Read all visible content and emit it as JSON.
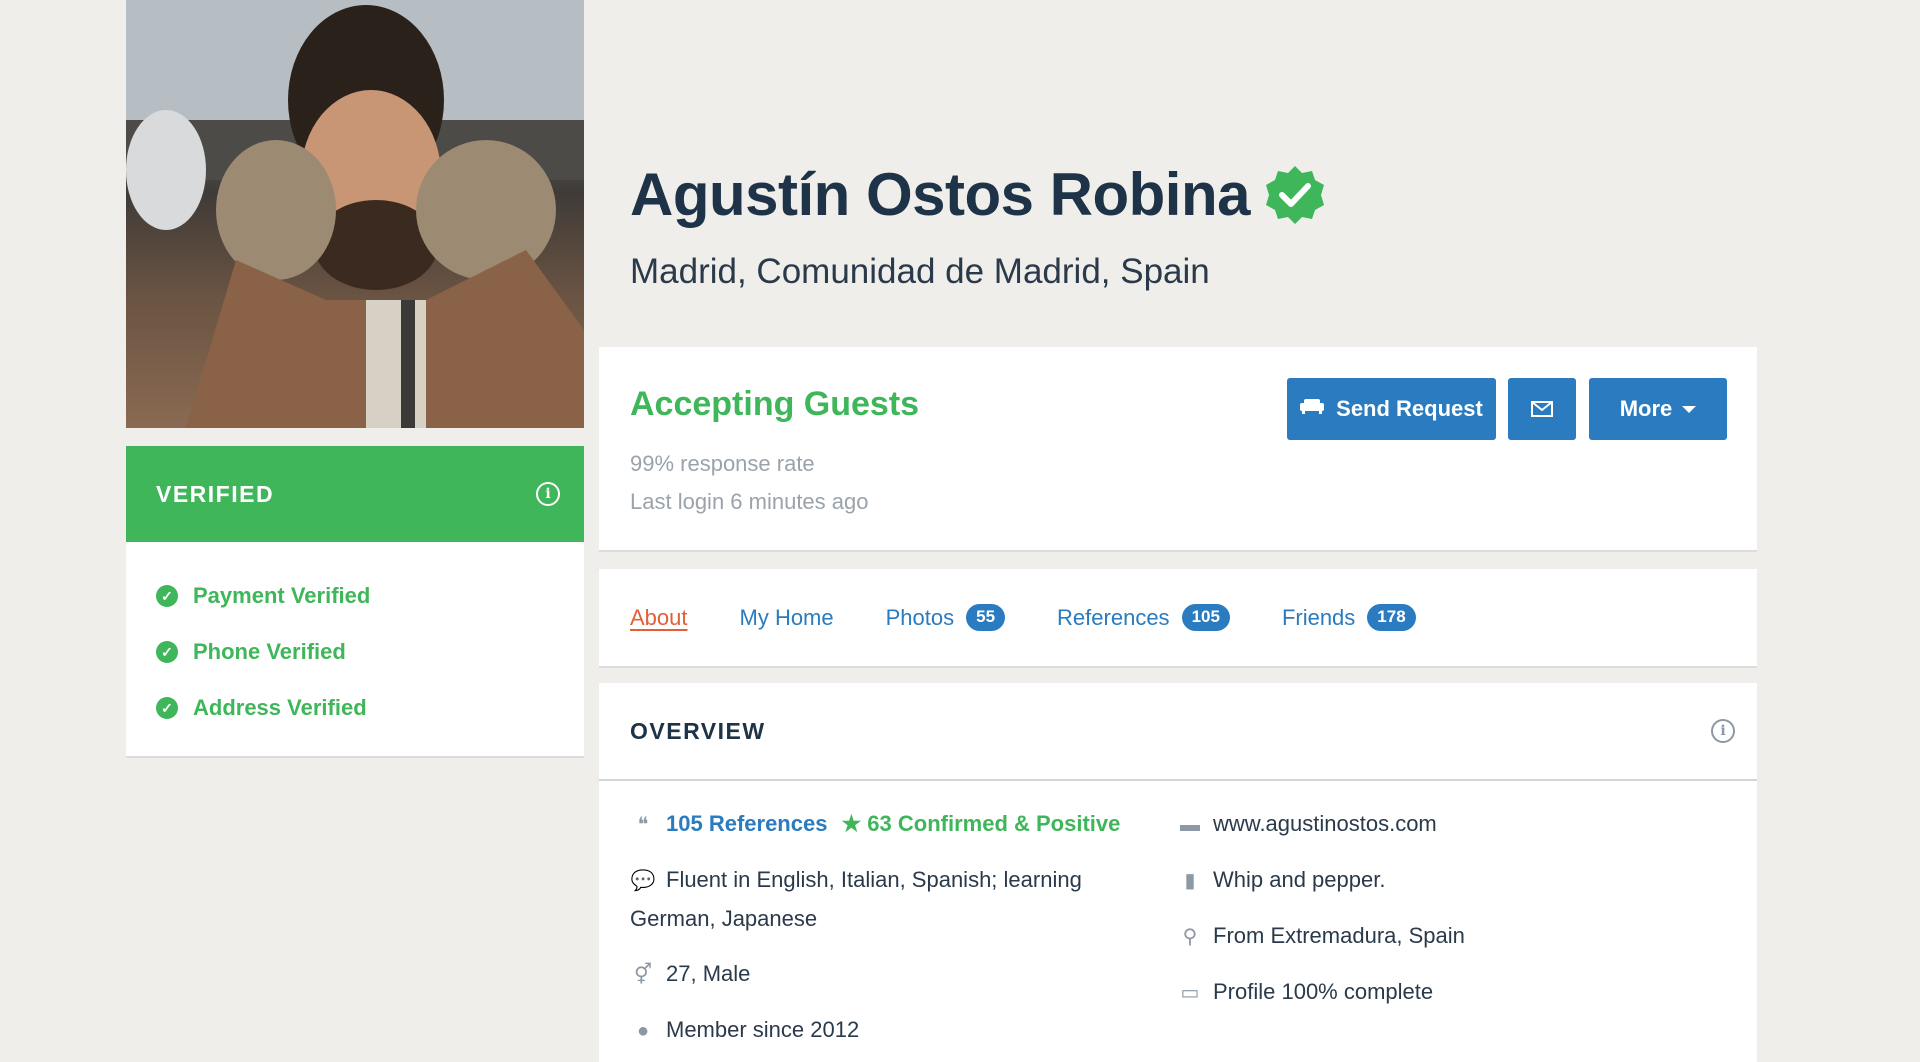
{
  "profile": {
    "name": "Agustín Ostos Robina",
    "location": "Madrid, Comunidad de Madrid, Spain"
  },
  "verified": {
    "title": "VERIFIED",
    "items": [
      {
        "label": "Payment Verified"
      },
      {
        "label": "Phone Verified"
      },
      {
        "label": "Address Verified"
      }
    ]
  },
  "status": {
    "headline": "Accepting Guests",
    "response_rate": "99% response rate",
    "last_login": "Last login 6 minutes ago",
    "send_label": "Send Request",
    "more_label": "More"
  },
  "tabs": [
    {
      "label": "About",
      "active": true
    },
    {
      "label": "My Home"
    },
    {
      "label": "Photos",
      "count": "55"
    },
    {
      "label": "References",
      "count": "105"
    },
    {
      "label": "Friends",
      "count": "178"
    }
  ],
  "overview": {
    "title": "OVERVIEW",
    "references": "105 References",
    "confirmed": "63 Confirmed & Positive",
    "languages": "Fluent in English, Italian, Spanish; learning German, Japanese",
    "age_gender": "27, Male",
    "member_since": "Member since 2012",
    "website": "www.agustinostos.com",
    "occupation": "Whip and pepper.",
    "from": "From Extremadura, Spain",
    "profile_complete": "Profile 100% complete"
  },
  "colors": {
    "accent_blue": "#2a7bbf",
    "verified_green": "#3fb65a",
    "active_tab": "#e0603a"
  }
}
